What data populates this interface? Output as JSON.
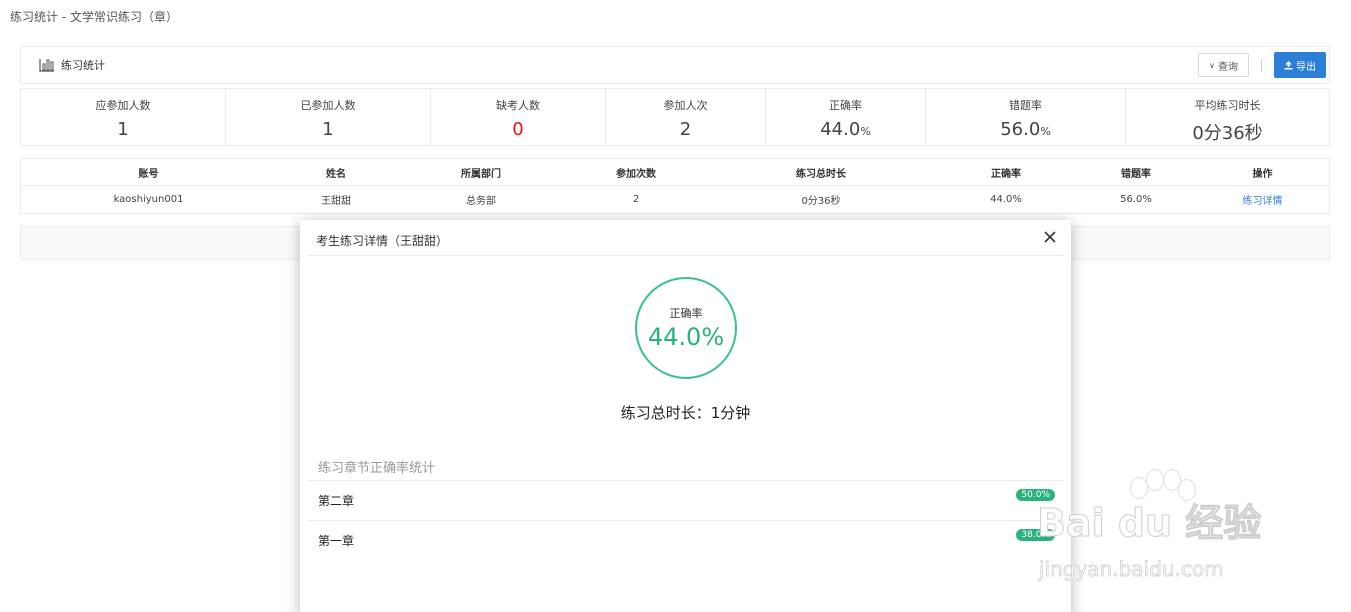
{
  "breadcrumb": "练习统计 - 文学常识练习（章）",
  "panel": {
    "title": "练习统计",
    "query_label": "查询",
    "export_label": "导出"
  },
  "stats": [
    {
      "label": "应参加人数",
      "value": "1"
    },
    {
      "label": "已参加人数",
      "value": "1"
    },
    {
      "label": "缺考人数",
      "value": "0"
    },
    {
      "label": "参加人次",
      "value": "2"
    },
    {
      "label": "正确率",
      "value": "44.0",
      "unit": "%"
    },
    {
      "label": "错题率",
      "value": "56.0",
      "unit": "%"
    },
    {
      "label": "平均练习时长",
      "value": "0分36秒"
    }
  ],
  "table": {
    "headers": [
      "账号",
      "姓名",
      "所属部门",
      "参加次数",
      "练习总时长",
      "正确率",
      "错题率",
      "操作"
    ],
    "rows": [
      [
        "kaoshiyun001",
        "王甜甜",
        "总务部",
        "2",
        "0分36秒",
        "44.0%",
        "56.0%",
        "练习详情"
      ]
    ]
  },
  "modal": {
    "title": "考生练习详情（王甜甜）",
    "rate_label": "正确率",
    "rate_value": "44.0%",
    "duration": "练习总时长：1分钟",
    "section_title": "练习章节正确率统计",
    "chapters": [
      {
        "name": "第二章",
        "rate": "50.0%"
      },
      {
        "name": "第一章",
        "rate": "38.0%"
      }
    ]
  },
  "watermark": {
    "brand": "Bai du 经验",
    "url": "jingyan.baidu.com"
  },
  "colors": {
    "accent": "#2d7ed6",
    "success": "#27b37a",
    "danger": "#ee1111"
  }
}
